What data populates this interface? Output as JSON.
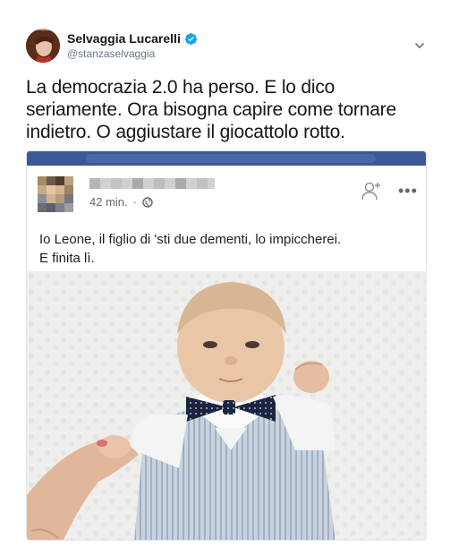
{
  "user": {
    "display_name": "Selvaggia Lucarelli",
    "handle": "@stanzaselvaggia"
  },
  "tweet": {
    "text": "La democrazia 2.0 ha perso. E lo dico seriamente. Ora bisogna capire come tornare indietro. O aggiustare il giocattolo rotto."
  },
  "embedded_post": {
    "time": "42 min.",
    "separator": "·",
    "text_line1": "Io Leone, il figlio di 'sti due dementi, lo impiccherei.",
    "text_line2": "E finita lì.",
    "more_label": "•••"
  },
  "icons": [
    "verified-badge-icon",
    "chevron-down-icon",
    "globe-icon",
    "add-friend-icon",
    "more-options-icon"
  ],
  "colors": {
    "verified": "#1da1f2",
    "facebook_blue": "#3b5998",
    "handle_gray": "#657786"
  }
}
